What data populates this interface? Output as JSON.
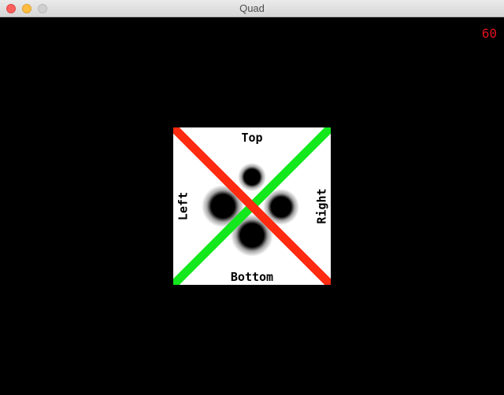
{
  "window": {
    "title": "Quad"
  },
  "overlay": {
    "fps": "60"
  },
  "quad": {
    "labels": {
      "top": "Top",
      "bottom": "Bottom",
      "left": "Left",
      "right": "Right"
    },
    "colors": {
      "background": "#ffffff",
      "diagonal_red": "#ff2a10",
      "diagonal_green": "#12e81c",
      "blob": "#000000",
      "fps_text": "#e0121e"
    }
  }
}
